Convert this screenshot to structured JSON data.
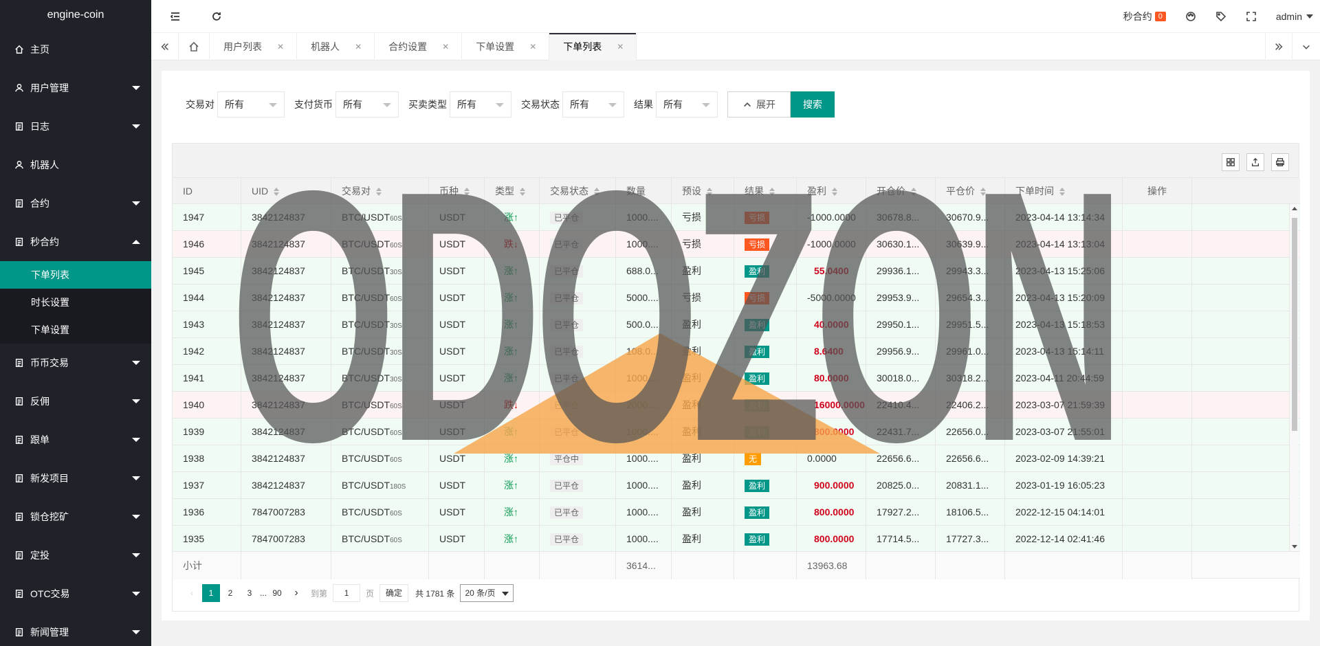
{
  "app": {
    "name": "engine-coin"
  },
  "sidebar": {
    "items": [
      {
        "label": "主页",
        "icon": "home-icon",
        "caret": ""
      },
      {
        "label": "用户管理",
        "icon": "user-icon",
        "caret": "down"
      },
      {
        "label": "日志",
        "icon": "doc-icon",
        "caret": "down"
      },
      {
        "label": "机器人",
        "icon": "user-icon",
        "caret": ""
      },
      {
        "label": "合约",
        "icon": "doc-icon",
        "caret": "down"
      },
      {
        "label": "秒合约",
        "icon": "doc-icon",
        "caret": "up"
      }
    ],
    "sub_items": [
      {
        "label": "下单列表",
        "active": true
      },
      {
        "label": "时长设置",
        "active": false
      },
      {
        "label": "下单设置",
        "active": false
      }
    ],
    "items_after": [
      {
        "label": "币币交易",
        "icon": "doc-icon"
      },
      {
        "label": "反佣",
        "icon": "doc-icon"
      },
      {
        "label": "跟单",
        "icon": "doc-icon"
      },
      {
        "label": "新发项目",
        "icon": "doc-icon"
      },
      {
        "label": "锁仓挖矿",
        "icon": "doc-icon"
      },
      {
        "label": "定投",
        "icon": "doc-icon"
      },
      {
        "label": "OTC交易",
        "icon": "doc-icon"
      },
      {
        "label": "新闻管理",
        "icon": "doc-icon"
      }
    ]
  },
  "header": {
    "notice_label": "秒合约",
    "notice_count": "0",
    "user": "admin"
  },
  "tabs": [
    {
      "label": "用户列表",
      "active": false
    },
    {
      "label": "机器人",
      "active": false
    },
    {
      "label": "合约设置",
      "active": false
    },
    {
      "label": "下单设置",
      "active": false
    },
    {
      "label": "下单列表",
      "active": true
    }
  ],
  "filters": [
    {
      "label": "交易对",
      "value": "所有"
    },
    {
      "label": "支付货币",
      "value": "所有"
    },
    {
      "label": "买卖类型",
      "value": "所有"
    },
    {
      "label": "交易状态",
      "value": "所有"
    },
    {
      "label": "结果",
      "value": "所有"
    }
  ],
  "buttons": {
    "expand": "展开",
    "search": "搜索"
  },
  "table": {
    "columns": [
      "ID",
      "UID",
      "交易对",
      "币种",
      "类型",
      "交易状态",
      "数量",
      "预设",
      "结果",
      "盈利",
      "开仓价",
      "平仓价",
      "下单时间",
      "操作"
    ],
    "rows": [
      {
        "id": "1947",
        "uid": "3842124837",
        "pair": "BTC/USDT",
        "period": "60S",
        "coin": "USDT",
        "dir": "up",
        "dir_label": "涨",
        "status": "已平仓",
        "qty": "1000....",
        "preset": "亏损",
        "result": "亏损",
        "result_color": "red",
        "profit": "-1000.0000",
        "open": "30678.8...",
        "close": "30670.9...",
        "time": "2023-04-14 13:14:34"
      },
      {
        "id": "1946",
        "uid": "3842124837",
        "pair": "BTC/USDT",
        "period": "60S",
        "coin": "USDT",
        "dir": "down",
        "dir_label": "跌",
        "status": "已平仓",
        "qty": "1000....",
        "preset": "亏损",
        "result": "亏损",
        "result_color": "red",
        "profit": "-1000.0000",
        "open": "30630.1...",
        "close": "30639.9...",
        "time": "2023-04-14 13:13:04"
      },
      {
        "id": "1945",
        "uid": "3842124837",
        "pair": "BTC/USDT",
        "period": "30S",
        "coin": "USDT",
        "dir": "up",
        "dir_label": "涨",
        "status": "已平仓",
        "qty": "688.0...",
        "preset": "盈利",
        "result": "盈利",
        "result_color": "green",
        "profit": "55.0400",
        "open": "29936.1...",
        "close": "29943.3...",
        "time": "2023-04-13 15:25:06"
      },
      {
        "id": "1944",
        "uid": "3842124837",
        "pair": "BTC/USDT",
        "period": "60S",
        "coin": "USDT",
        "dir": "up",
        "dir_label": "涨",
        "status": "已平仓",
        "qty": "5000....",
        "preset": "亏损",
        "result": "亏损",
        "result_color": "red",
        "profit": "-5000.0000",
        "open": "29953.9...",
        "close": "29654.3...",
        "time": "2023-04-13 15:20:09"
      },
      {
        "id": "1943",
        "uid": "3842124837",
        "pair": "BTC/USDT",
        "period": "30S",
        "coin": "USDT",
        "dir": "up",
        "dir_label": "涨",
        "status": "已平仓",
        "qty": "500.0...",
        "preset": "盈利",
        "result": "盈利",
        "result_color": "green",
        "profit": "40.0000",
        "open": "29950.1...",
        "close": "29951.5...",
        "time": "2023-04-13 15:18:53"
      },
      {
        "id": "1942",
        "uid": "3842124837",
        "pair": "BTC/USDT",
        "period": "30S",
        "coin": "USDT",
        "dir": "up",
        "dir_label": "涨",
        "status": "已平仓",
        "qty": "108.0...",
        "preset": "盈利",
        "result": "盈利",
        "result_color": "green",
        "profit": "8.6400",
        "open": "29956.9...",
        "close": "29961.0...",
        "time": "2023-04-13 15:14:11"
      },
      {
        "id": "1941",
        "uid": "3842124837",
        "pair": "BTC/USDT",
        "period": "30S",
        "coin": "USDT",
        "dir": "up",
        "dir_label": "涨",
        "status": "已平仓",
        "qty": "1000....",
        "preset": "盈利",
        "result": "盈利",
        "result_color": "green",
        "profit": "80.0000",
        "open": "30018.0...",
        "close": "30318.2...",
        "time": "2023-04-11 20:44:59"
      },
      {
        "id": "1940",
        "uid": "3842124837",
        "pair": "BTC/USDT",
        "period": "60S",
        "coin": "USDT",
        "dir": "down",
        "dir_label": "跌",
        "status": "已平仓",
        "qty": "2000....",
        "preset": "盈利",
        "result": "盈利",
        "result_color": "green",
        "profit": "16000.0000",
        "open": "22410.4...",
        "close": "22406.2...",
        "time": "2023-03-07 21:59:39"
      },
      {
        "id": "1939",
        "uid": "3842124837",
        "pair": "BTC/USDT",
        "period": "60S",
        "coin": "USDT",
        "dir": "up",
        "dir_label": "涨",
        "status": "已平仓",
        "qty": "1000....",
        "preset": "盈利",
        "result": "盈利",
        "result_color": "green",
        "profit": "800.0000",
        "open": "22431.7...",
        "close": "22656.0...",
        "time": "2023-03-07 21:55:01"
      },
      {
        "id": "1938",
        "uid": "3842124837",
        "pair": "BTC/USDT",
        "period": "60S",
        "coin": "USDT",
        "dir": "up",
        "dir_label": "涨",
        "status": "平仓中",
        "qty": "1000....",
        "preset": "盈利",
        "result": "无",
        "result_color": "orange",
        "profit": "0.0000",
        "open": "22656.6...",
        "close": "22656.6...",
        "time": "2023-02-09 14:39:21"
      },
      {
        "id": "1937",
        "uid": "3842124837",
        "pair": "BTC/USDT",
        "period": "180S",
        "coin": "USDT",
        "dir": "up",
        "dir_label": "涨",
        "status": "已平仓",
        "qty": "1000....",
        "preset": "盈利",
        "result": "盈利",
        "result_color": "green",
        "profit": "900.0000",
        "open": "20825.0...",
        "close": "20831.1...",
        "time": "2023-01-19 16:05:23"
      },
      {
        "id": "1936",
        "uid": "7847007283",
        "pair": "BTC/USDT",
        "period": "60S",
        "coin": "USDT",
        "dir": "up",
        "dir_label": "涨",
        "status": "已平仓",
        "qty": "1000....",
        "preset": "盈利",
        "result": "盈利",
        "result_color": "green",
        "profit": "800.0000",
        "open": "17927.2...",
        "close": "18106.5...",
        "time": "2022-12-15 04:14:01"
      },
      {
        "id": "1935",
        "uid": "7847007283",
        "pair": "BTC/USDT",
        "period": "60S",
        "coin": "USDT",
        "dir": "up",
        "dir_label": "涨",
        "status": "已平仓",
        "qty": "1000....",
        "preset": "盈利",
        "result": "盈利",
        "result_color": "green",
        "profit": "800.0000",
        "open": "17714.5...",
        "close": "17727.3...",
        "time": "2022-12-14 02:41:46"
      }
    ],
    "subtotal": {
      "label": "小计",
      "qty": "3614...",
      "profit": "13963.68"
    }
  },
  "pagination": {
    "pages": [
      "1",
      "2",
      "3",
      "...",
      "90"
    ],
    "goto_label": "到第",
    "goto_value": "1",
    "page_unit": "页",
    "confirm": "确定",
    "total": "共 1781 条",
    "page_size": "20 条/页"
  },
  "watermark": {
    "text": "ODOZON"
  },
  "colors": {
    "primary": "#009688",
    "sidebar": "#20222a",
    "danger": "#ff5722",
    "profit": "#d0021b",
    "up": "#0a9a52",
    "down": "#cc0000"
  }
}
